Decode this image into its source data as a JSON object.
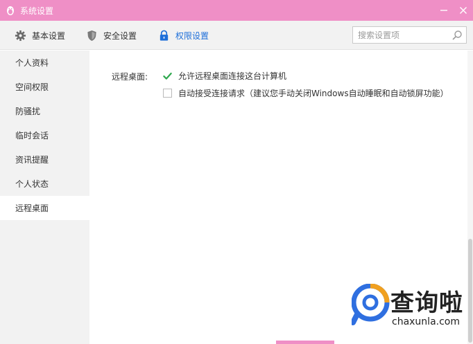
{
  "window": {
    "title": "系统设置",
    "accent_color": "#ef8fc6"
  },
  "tabs": [
    {
      "label": "基本设置",
      "icon": "gear-icon",
      "active": false
    },
    {
      "label": "安全设置",
      "icon": "shield-icon",
      "active": false
    },
    {
      "label": "权限设置",
      "icon": "lock-icon",
      "active": true
    }
  ],
  "search": {
    "placeholder": "搜索设置项",
    "value": ""
  },
  "sidebar": {
    "items": [
      {
        "label": "个人资料",
        "active": false
      },
      {
        "label": "空间权限",
        "active": false
      },
      {
        "label": "防骚扰",
        "active": false
      },
      {
        "label": "临时会话",
        "active": false
      },
      {
        "label": "资讯提醒",
        "active": false
      },
      {
        "label": "个人状态",
        "active": false
      },
      {
        "label": "远程桌面",
        "active": true
      }
    ]
  },
  "content": {
    "section_label": "远程桌面:",
    "options": [
      {
        "label": "允许远程桌面连接这台计算机",
        "checked": true
      },
      {
        "label": "自动接受连接请求（建议您手动关闭Windows自动睡眠和自动锁屏功能）",
        "checked": false
      }
    ]
  },
  "watermark": {
    "text_cn": "查询啦",
    "text_en": "chaxunla.com"
  }
}
